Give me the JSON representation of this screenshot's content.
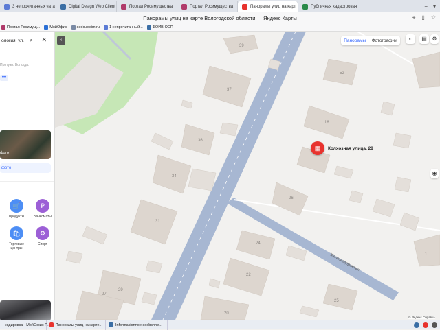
{
  "browser": {
    "tabs": [
      {
        "label": "3 непрочитанных чата",
        "color": "#5b7bd5"
      },
      {
        "label": "Digital Design Web Client",
        "color": "#3a6ea5"
      },
      {
        "label": "Портал Росимущества",
        "color": "#b03a6a"
      },
      {
        "label": "Портал Росимущества",
        "color": "#b03a6a"
      },
      {
        "label": "Панорамы улиц на карт",
        "color": "#e8332e",
        "active": true
      },
      {
        "label": "Публичная кадастровая",
        "color": "#2a8a4a"
      }
    ],
    "window_title": "Панорамы улиц на карте Вологодской области — Яндекс Карты",
    "bookmarks": [
      {
        "label": "Портал Росимущ...",
        "color": "#b03a6a"
      },
      {
        "label": "МойОфис",
        "color": "#2a6fd5"
      },
      {
        "label": "sedo.rosim.ru",
        "color": "#7a8aa5"
      },
      {
        "label": "1 непрочитанный...",
        "color": "#5b7bd5"
      },
      {
        "label": "ФОИВ-ОСП",
        "color": "#3a6ea5"
      }
    ]
  },
  "sidebar": {
    "search_value": "ология. ул.",
    "address": "Притузн. Вологда.",
    "more_dots": "•••",
    "photo_label": "фото",
    "photo_button": "фото",
    "categories": [
      {
        "label": "Продукты",
        "icon": "🛒",
        "color": "#4d8ef5"
      },
      {
        "label": "Банкоматы",
        "icon": "₽",
        "color": "#9c5fd6"
      },
      {
        "label": "Торговые центры",
        "icon": "🛍",
        "color": "#4d8ef5"
      },
      {
        "label": "Спорт",
        "icon": "⚙",
        "color": "#9c5fd6"
      }
    ]
  },
  "map": {
    "tabs": {
      "panoramas": "Панорамы",
      "photos": "Фотографии"
    },
    "pin_label": "Колхозная улица, 28",
    "house_numbers": [
      "39",
      "52",
      "37",
      "18",
      "36",
      "34",
      "26",
      "31",
      "24",
      "22",
      "29",
      "25",
      "27",
      "20",
      "1"
    ],
    "street_labels": [
      "Железнодорожная"
    ],
    "attribution": "© Яндекс  Справка"
  },
  "taskbar": {
    "items": [
      {
        "label": "кодировка - МойОфис П...",
        "color": "#2a6fd5"
      },
      {
        "label": "Панорамы улиц на карте...",
        "color": "#e8332e"
      },
      {
        "label": "Informacionnoe soobshhe...",
        "color": "#3a6ea5"
      }
    ]
  }
}
